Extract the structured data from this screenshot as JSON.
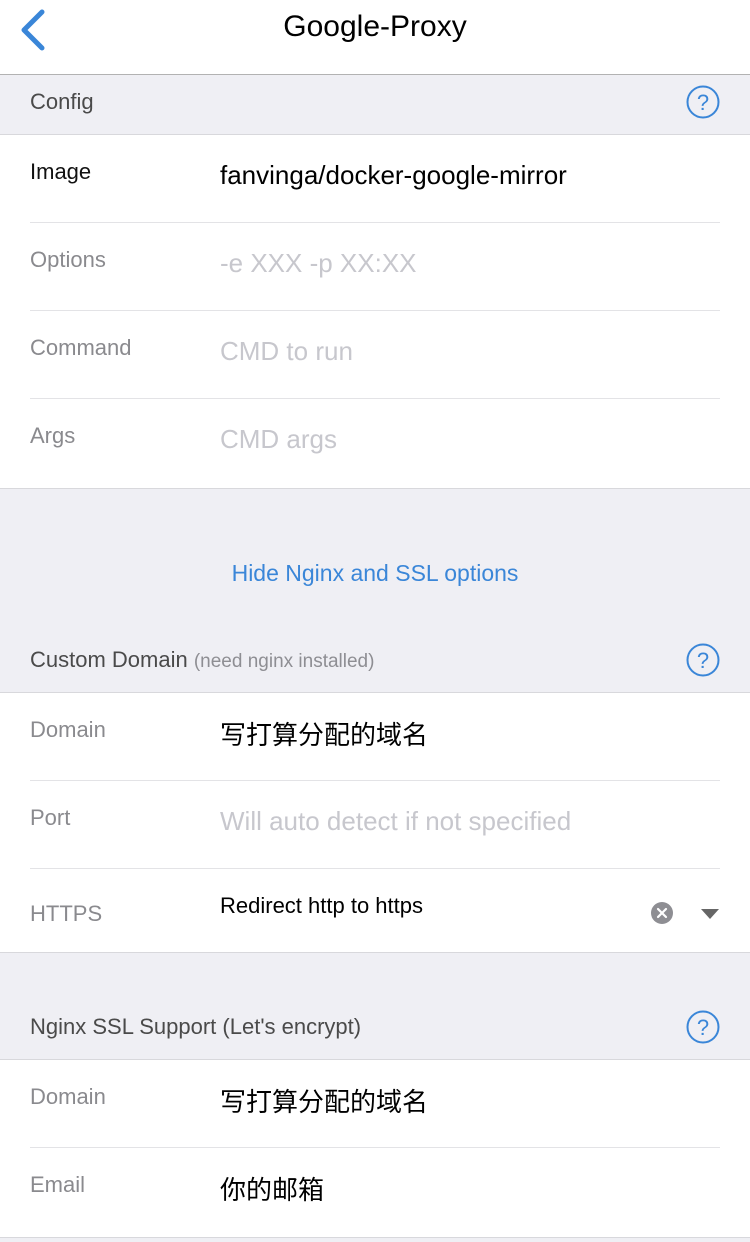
{
  "navbar": {
    "title": "Google-Proxy"
  },
  "config": {
    "header": "Config",
    "rows": {
      "image": {
        "label": "Image",
        "value": "fanvinga/docker-google-mirror",
        "placeholder": ""
      },
      "options": {
        "label": "Options",
        "value": "",
        "placeholder": "-e XXX -p XX:XX"
      },
      "command": {
        "label": "Command",
        "value": "",
        "placeholder": "CMD to run"
      },
      "args": {
        "label": "Args",
        "value": "",
        "placeholder": "CMD args"
      }
    }
  },
  "toggle_link": "Hide Nginx and SSL options",
  "custom_domain": {
    "header": "Custom Domain",
    "header_note": "(need nginx installed)",
    "rows": {
      "domain": {
        "label": "Domain",
        "value": "写打算分配的域名",
        "placeholder": ""
      },
      "port": {
        "label": "Port",
        "value": "",
        "placeholder": "Will auto detect if not specified"
      },
      "https": {
        "label": "HTTPS",
        "selected": "Redirect http to https"
      }
    }
  },
  "ssl": {
    "header": "Nginx SSL Support (Let's encrypt)",
    "rows": {
      "domain": {
        "label": "Domain",
        "value": "写打算分配的域名",
        "placeholder": ""
      },
      "email": {
        "label": "Email",
        "value": "你的邮箱",
        "placeholder": ""
      }
    }
  },
  "colors": {
    "accent": "#3a86d8",
    "background": "#efeff4"
  },
  "icons": [
    "chevron-left-icon",
    "help-icon",
    "clear-icon",
    "caret-down-icon"
  ]
}
